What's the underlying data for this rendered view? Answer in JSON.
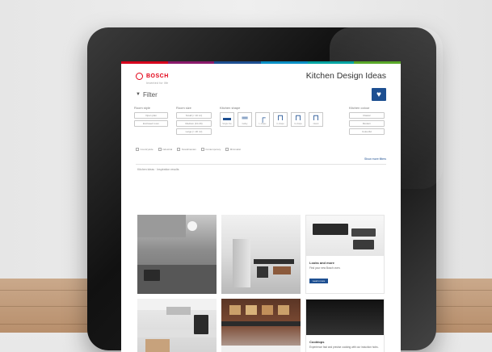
{
  "app": {
    "brand_name": "BOSCH",
    "brand_tagline": "Invented for life",
    "page_title": "Kitchen Design Ideas",
    "colorbar": [
      "#d6001c",
      "#8a1a6b",
      "#1d4f91",
      "#0a8fc4",
      "#00a3a1",
      "#5aa829"
    ]
  },
  "filter": {
    "label": "Filter",
    "favorite_icon": "heart-icon",
    "groups": [
      {
        "title": "Room style",
        "options": [
          "Open plan",
          "Enclosed room"
        ]
      },
      {
        "title": "Room size",
        "options": [
          "Small (< 10 m²)",
          "Medium (10-20)",
          "Large (> 20 m²)"
        ]
      },
      {
        "title": "Kitchen shape",
        "shapes": [
          {
            "label": "Single line",
            "glyph": "▬"
          },
          {
            "label": "Galley",
            "glyph": "═"
          },
          {
            "label": "L-shape",
            "glyph": "┌"
          },
          {
            "label": "U-shape",
            "glyph": "⊓"
          },
          {
            "label": "G-shape",
            "glyph": "⊓"
          },
          {
            "label": "Island",
            "glyph": "⊓"
          }
        ]
      },
      {
        "title": "Kitchen colour",
        "options": [
          "Classic",
          "Modern",
          "Colourful"
        ]
      }
    ],
    "checkboxes": [
      "Countryside",
      "Industrial",
      "Scandinavian",
      "Contemporary",
      "Minimalist"
    ],
    "show_more": "Show more filters"
  },
  "results": {
    "label": "Kitchen ideas · Inspiration results",
    "cards": [
      {
        "title": "Looks and more",
        "text": "Find your new Bosch oven.",
        "button": "Learn more"
      },
      {
        "title": "Cooktops",
        "text": "Experience fast and precise cooking with our induction hobs."
      }
    ]
  }
}
